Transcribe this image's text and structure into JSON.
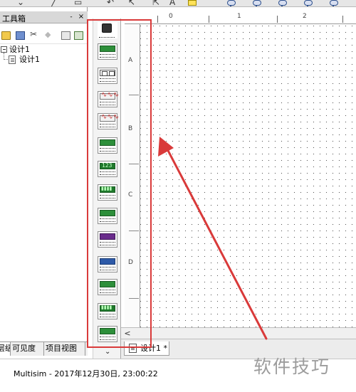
{
  "left_panel": {
    "title": "工具箱",
    "pin": "-",
    "close": "×",
    "tree": {
      "root": "设计1",
      "child": "设计1"
    },
    "tabs": [
      "层级",
      "可见度",
      "项目视图"
    ]
  },
  "canvas": {
    "ruler_top_labels": [
      "0",
      "1",
      "2"
    ],
    "ruler_left_labels": [
      "A",
      "B",
      "C",
      "D"
    ]
  },
  "scroll_left": "<",
  "doc_tab": "设计1 *",
  "instr_more": "⌄",
  "status": "Multisim  -  2017年12月30日, 23:00:22",
  "watermark": "软件技巧",
  "colors": {
    "annotation": "#d93a3a",
    "panel_header": "#d8d8d8",
    "instrument_green": "#2d8f3a"
  }
}
